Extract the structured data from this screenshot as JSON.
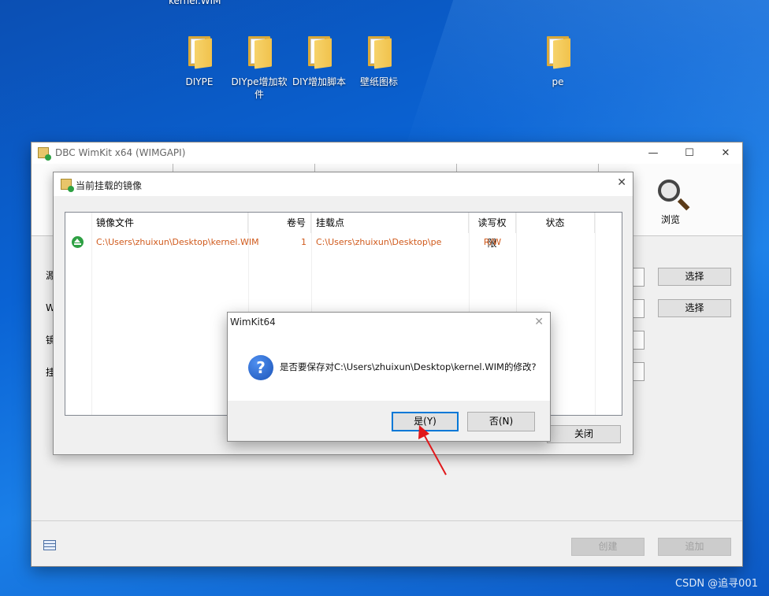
{
  "desktop": {
    "top_label": "kernel.WIM",
    "icons": [
      {
        "label": "DIYPE"
      },
      {
        "label": "DIYpe增加软件"
      },
      {
        "label": "DIY增加脚本"
      },
      {
        "label": "壁纸图标"
      },
      {
        "label": "pe"
      }
    ]
  },
  "main_window": {
    "title": "DBC WimKit x64 (WIMGAPI)",
    "controls": {
      "minimize": "—",
      "maximize": "☐",
      "close": "✕"
    },
    "toolbar": {
      "browse_label": "浏览"
    },
    "side_labels": [
      "源",
      "W",
      "镜",
      "挂"
    ],
    "buttons": {
      "select_1": "选择",
      "select_2": "选择",
      "create": "创建",
      "append": "追加"
    }
  },
  "mount_window": {
    "title": "当前挂载的镜像",
    "close": "✕",
    "columns": [
      "镜像文件",
      "卷号",
      "挂载点",
      "读写权限",
      "状态"
    ],
    "rows": [
      {
        "image_file": "C:\\Users\\zhuixun\\Desktop\\kernel.WIM",
        "volume": "1",
        "mount_point": "C:\\Users\\zhuixun\\Desktop\\pe",
        "access": "R/W",
        "status": ""
      }
    ],
    "close_button": "关闭"
  },
  "message_box": {
    "title": "WimKit64",
    "close": "✕",
    "icon": "question-icon",
    "icon_glyph": "?",
    "message": "是否要保存对C:\\Users\\zhuixun\\Desktop\\kernel.WIM的修改?",
    "yes_label": "是(Y)",
    "no_label": "否(N)"
  },
  "watermark": "CSDN @追寻001",
  "colors": {
    "accent": "#0078d7",
    "row_text": "#d05a1c",
    "annotation_arrow": "#e0181b"
  }
}
